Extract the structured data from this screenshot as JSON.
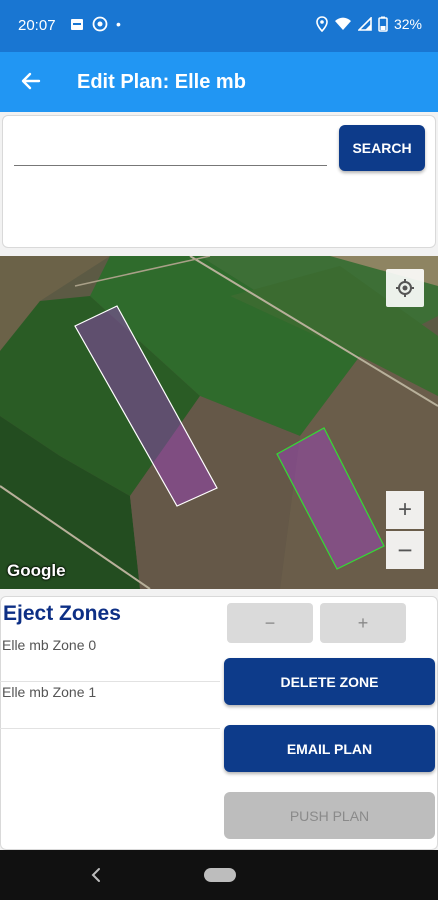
{
  "status_bar": {
    "time": "20:07",
    "dot": "•",
    "battery": "32%",
    "icons": [
      "calendar-icon",
      "whatsapp-icon",
      "location-icon",
      "wifi-icon",
      "signal-icon",
      "battery-icon"
    ]
  },
  "app_bar": {
    "title": "Edit Plan: Elle mb",
    "back_icon": "arrow-back-icon"
  },
  "search": {
    "value": "",
    "button_label": "SEARCH"
  },
  "map": {
    "attribution": "Google",
    "zoom_in_label": "+",
    "zoom_out_label": "−",
    "locate_icon": "my-location-icon",
    "zone_colors": {
      "selected_outline": "#ffffff",
      "normal_outline": "#33dd33",
      "fill": "#a040c8"
    }
  },
  "zones": {
    "title": "Eject Zones",
    "items": [
      {
        "label": "Elle mb Zone 0"
      },
      {
        "label": "Elle mb Zone 1"
      }
    ],
    "minus_label": "−",
    "plus_label": "+",
    "delete_label": "DELETE ZONE",
    "email_label": "EMAIL PLAN",
    "push_label": "PUSH PLAN"
  },
  "nav_bar": {
    "back_icon": "nav-back-icon",
    "home_icon": "nav-home-pill"
  },
  "colors": {
    "status_bar": "#1976d2",
    "app_bar": "#2196f3",
    "primary_button": "#0d3b8a",
    "title_text": "#0d2f85"
  }
}
